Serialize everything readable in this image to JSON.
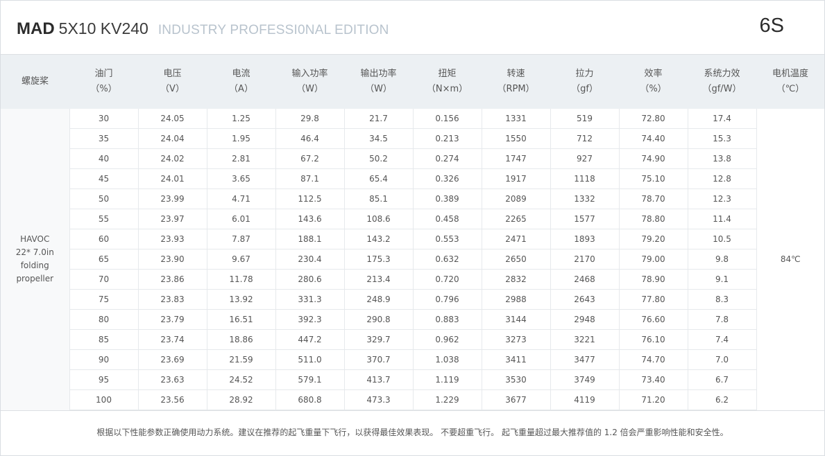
{
  "header": {
    "brand": "MAD",
    "model": "5X10 KV240",
    "edition": "INDUSTRY PROFESSI0NAL EDITION",
    "cells": "6S"
  },
  "columns": [
    {
      "name": "螺旋桨",
      "unit": ""
    },
    {
      "name": "油门",
      "unit": "（%）"
    },
    {
      "name": "电压",
      "unit": "（V）"
    },
    {
      "name": "电流",
      "unit": "（A）"
    },
    {
      "name": "输入功率",
      "unit": "（W）"
    },
    {
      "name": "输出功率",
      "unit": "（W）"
    },
    {
      "name": "扭矩",
      "unit": "（N×m）"
    },
    {
      "name": "转速",
      "unit": "（RPM）"
    },
    {
      "name": "拉力",
      "unit": "（gf）"
    },
    {
      "name": "效率",
      "unit": "（%）"
    },
    {
      "name": "系统力效",
      "unit": "（gf/W）"
    },
    {
      "name": "电机温度",
      "unit": "（℃）"
    }
  ],
  "propeller": [
    "HAVOC",
    "22* 7.0in",
    "folding",
    "propeller"
  ],
  "motor_temp": "84℃",
  "rows": [
    [
      "30",
      "24.05",
      "1.25",
      "29.8",
      "21.7",
      "0.156",
      "1331",
      "519",
      "72.80",
      "17.4"
    ],
    [
      "35",
      "24.04",
      "1.95",
      "46.4",
      "34.5",
      "0.213",
      "1550",
      "712",
      "74.40",
      "15.3"
    ],
    [
      "40",
      "24.02",
      "2.81",
      "67.2",
      "50.2",
      "0.274",
      "1747",
      "927",
      "74.90",
      "13.8"
    ],
    [
      "45",
      "24.01",
      "3.65",
      "87.1",
      "65.4",
      "0.326",
      "1917",
      "1118",
      "75.10",
      "12.8"
    ],
    [
      "50",
      "23.99",
      "4.71",
      "112.5",
      "85.1",
      "0.389",
      "2089",
      "1332",
      "78.70",
      "12.3"
    ],
    [
      "55",
      "23.97",
      "6.01",
      "143.6",
      "108.6",
      "0.458",
      "2265",
      "1577",
      "78.80",
      "11.4"
    ],
    [
      "60",
      "23.93",
      "7.87",
      "188.1",
      "143.2",
      "0.553",
      "2471",
      "1893",
      "79.20",
      "10.5"
    ],
    [
      "65",
      "23.90",
      "9.67",
      "230.4",
      "175.3",
      "0.632",
      "2650",
      "2170",
      "79.00",
      "9.8"
    ],
    [
      "70",
      "23.86",
      "11.78",
      "280.6",
      "213.4",
      "0.720",
      "2832",
      "2468",
      "78.90",
      "9.1"
    ],
    [
      "75",
      "23.83",
      "13.92",
      "331.3",
      "248.9",
      "0.796",
      "2988",
      "2643",
      "77.80",
      "8.3"
    ],
    [
      "80",
      "23.79",
      "16.51",
      "392.3",
      "290.8",
      "0.883",
      "3144",
      "2948",
      "76.60",
      "7.8"
    ],
    [
      "85",
      "23.74",
      "18.86",
      "447.2",
      "329.7",
      "0.962",
      "3273",
      "3221",
      "76.10",
      "7.4"
    ],
    [
      "90",
      "23.69",
      "21.59",
      "511.0",
      "370.7",
      "1.038",
      "3411",
      "3477",
      "74.70",
      "7.0"
    ],
    [
      "95",
      "23.63",
      "24.52",
      "579.1",
      "413.7",
      "1.119",
      "3530",
      "3749",
      "73.40",
      "6.7"
    ],
    [
      "100",
      "23.56",
      "28.92",
      "680.8",
      "473.3",
      "1.229",
      "3677",
      "4119",
      "71.20",
      "6.2"
    ]
  ],
  "note": "根据以下性能参数正确使用动力系统。建议在推荐的起飞重量下飞行，以获得最佳效果表现。 不要超重飞行。 起飞重量超过最大推荐值的 1.2 倍会严重影响性能和安全性。"
}
